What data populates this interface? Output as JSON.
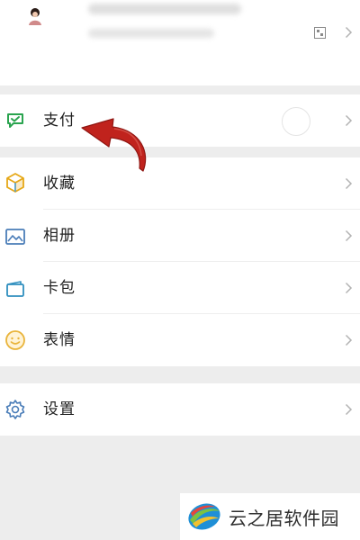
{
  "menu": {
    "pay": "支付",
    "favorites": "收藏",
    "album": "相册",
    "cards": "卡包",
    "stickers": "表情",
    "settings": "设置"
  },
  "colors": {
    "pay_icon": "#2aa44f",
    "favorites_icon": "#e6a817",
    "album_icon": "#4a7db8",
    "cards_icon": "#2f8fbf",
    "stickers_icon": "#e9b43b",
    "settings_icon": "#4a7db8",
    "arrow": "#c0231d"
  },
  "watermark": {
    "text": "云之居软件园"
  }
}
